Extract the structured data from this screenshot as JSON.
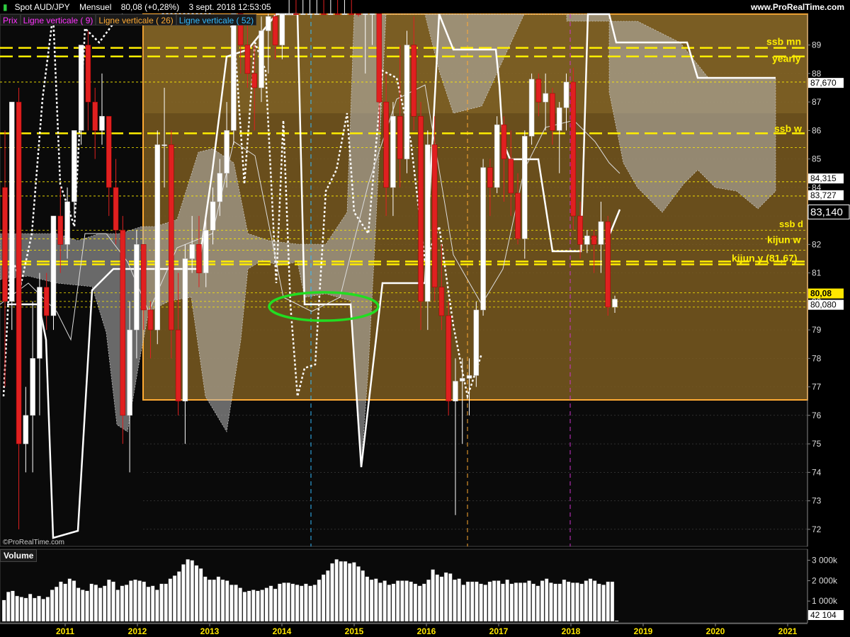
{
  "header": {
    "instrument": "Spot AUD/JPY",
    "period": "Mensuel",
    "last_change": "80,08 (+0,28%)",
    "datetime": "3 sept. 2018 12:53:05",
    "source": "www.ProRealTime.com"
  },
  "legend": [
    {
      "label": "Prix",
      "color": "#ff33ff"
    },
    {
      "label": "Ligne verticale ( 9)",
      "color": "#ff33ff"
    },
    {
      "label": "Ligne verticale ( 26)",
      "color": "#ffaa33"
    },
    {
      "label": "Ligne verticale ( 52)",
      "color": "#33bbff"
    }
  ],
  "watermark": "©ProRealTime.com",
  "volume_panel": {
    "title": "Volume",
    "last_value_label": "42 104"
  },
  "colors": {
    "bull_candle": "#ffffff",
    "bear_candle": "#e02020",
    "cloud": "#b8b8b8",
    "zone_fill": "#7a5a20",
    "zone_border": "#ffaa33",
    "key_level": "#ffee00",
    "highlight_ellipse": "#22dd22",
    "marker_9": "#cc33cc",
    "marker_26": "#ffaa33",
    "marker_52": "#33bbff"
  },
  "chart_data": {
    "type": "candlestick",
    "y_axis_ticks": [
      "72",
      "73",
      "74",
      "75",
      "76",
      "77",
      "78",
      "79",
      "80",
      "81",
      "82",
      "83",
      "84",
      "85",
      "86",
      "87",
      "88",
      "89"
    ],
    "y_range": [
      71.4,
      90.1
    ],
    "x_axis_ticks": [
      "2011",
      "2012",
      "2013",
      "2014",
      "2015",
      "2016",
      "2017",
      "2018",
      "2019",
      "2020",
      "2021"
    ],
    "price_labels": [
      "87,670",
      "84,315",
      "83,727",
      "83,140",
      "80,08",
      "80,080"
    ],
    "level_labels": [
      "ssb mn",
      "yearly",
      "ssb w",
      "ssb d",
      "kijun w",
      "kijun y (81,67)"
    ],
    "volume_axis_ticks": [
      "3 000k",
      "2 000k",
      "1 000k"
    ],
    "candles": [
      {
        "o": 84,
        "h": 86,
        "l": 77,
        "c": 80
      },
      {
        "o": 80,
        "h": 87,
        "l": 79,
        "c": 87
      },
      {
        "o": 87,
        "h": 87.5,
        "l": 72,
        "c": 75
      },
      {
        "o": 75,
        "h": 77,
        "l": 74,
        "c": 76
      },
      {
        "o": 76,
        "h": 80,
        "l": 74,
        "c": 78
      },
      {
        "o": 78,
        "h": 81,
        "l": 76,
        "c": 80.5
      },
      {
        "o": 80.5,
        "h": 81,
        "l": 79,
        "c": 79.5
      },
      {
        "o": 79.5,
        "h": 83,
        "l": 79,
        "c": 83
      },
      {
        "o": 83,
        "h": 84,
        "l": 81,
        "c": 82
      },
      {
        "o": 82,
        "h": 84,
        "l": 81.5,
        "c": 83.5
      },
      {
        "o": 83.5,
        "h": 86,
        "l": 83,
        "c": 86
      },
      {
        "o": 86,
        "h": 89,
        "l": 85.5,
        "c": 89
      },
      {
        "o": 89,
        "h": 89.5,
        "l": 86,
        "c": 87
      },
      {
        "o": 87,
        "h": 87.5,
        "l": 85,
        "c": 86
      },
      {
        "o": 86,
        "h": 88,
        "l": 85.5,
        "c": 86.5
      },
      {
        "o": 86.5,
        "h": 86.5,
        "l": 83,
        "c": 84
      },
      {
        "o": 84,
        "h": 85,
        "l": 82,
        "c": 82.5
      },
      {
        "o": 82.5,
        "h": 83,
        "l": 75,
        "c": 76
      },
      {
        "o": 76,
        "h": 80,
        "l": 74,
        "c": 79
      },
      {
        "o": 79,
        "h": 82.5,
        "l": 78,
        "c": 82
      },
      {
        "o": 82,
        "h": 82,
        "l": 79,
        "c": 79.7
      },
      {
        "o": 79.7,
        "h": 80,
        "l": 78,
        "c": 79
      },
      {
        "o": 79,
        "h": 86,
        "l": 78.5,
        "c": 85.5
      },
      {
        "o": 85.5,
        "h": 87.5,
        "l": 84,
        "c": 85.5
      },
      {
        "o": 85.5,
        "h": 86,
        "l": 78,
        "c": 79
      },
      {
        "o": 79,
        "h": 81,
        "l": 76,
        "c": 76.5
      },
      {
        "o": 76.5,
        "h": 82,
        "l": 75,
        "c": 81.5
      },
      {
        "o": 81.5,
        "h": 83,
        "l": 81,
        "c": 82
      },
      {
        "o": 82,
        "h": 83,
        "l": 80.5,
        "c": 81
      },
      {
        "o": 81,
        "h": 83,
        "l": 80.5,
        "c": 82.5
      },
      {
        "o": 82.5,
        "h": 84,
        "l": 82,
        "c": 83.5
      },
      {
        "o": 83.5,
        "h": 85,
        "l": 83,
        "c": 84.5
      },
      {
        "o": 84.5,
        "h": 87,
        "l": 84,
        "c": 86
      },
      {
        "o": 86,
        "h": 91,
        "l": 85.5,
        "c": 90.5
      },
      {
        "o": 90.5,
        "h": 92,
        "l": 88,
        "c": 89
      },
      {
        "o": 89,
        "h": 90,
        "l": 87.5,
        "c": 88
      },
      {
        "o": 88,
        "h": 89,
        "l": 86,
        "c": 87.5
      },
      {
        "o": 87.5,
        "h": 90,
        "l": 87,
        "c": 89.5
      },
      {
        "o": 89.5,
        "h": 90.5,
        "l": 88,
        "c": 90
      },
      {
        "o": 90,
        "h": 91,
        "l": 88.5,
        "c": 89
      },
      {
        "o": 89,
        "h": 92,
        "l": 88.5,
        "c": 91.5
      },
      {
        "o": 91.5,
        "h": 95,
        "l": 91,
        "c": 94
      },
      {
        "o": 94,
        "h": 96,
        "l": 92,
        "c": 93
      },
      {
        "o": 93,
        "h": 95,
        "l": 91,
        "c": 94.5
      },
      {
        "o": 94.5,
        "h": 97,
        "l": 93,
        "c": 96
      },
      {
        "o": 96,
        "h": 98,
        "l": 94,
        "c": 97
      },
      {
        "o": 97,
        "h": 99,
        "l": 95,
        "c": 96
      },
      {
        "o": 96,
        "h": 98,
        "l": 95,
        "c": 97.5
      },
      {
        "o": 97.5,
        "h": 99,
        "l": 93,
        "c": 94
      },
      {
        "o": 94,
        "h": 96,
        "l": 92,
        "c": 95
      },
      {
        "o": 95,
        "h": 97,
        "l": 92,
        "c": 93
      },
      {
        "o": 93,
        "h": 94,
        "l": 90,
        "c": 90.5
      },
      {
        "o": 90.5,
        "h": 92,
        "l": 88,
        "c": 91
      },
      {
        "o": 91,
        "h": 92.5,
        "l": 89,
        "c": 92
      },
      {
        "o": 92,
        "h": 93,
        "l": 86,
        "c": 87
      },
      {
        "o": 87,
        "h": 88,
        "l": 83,
        "c": 84
      },
      {
        "o": 84,
        "h": 87,
        "l": 83,
        "c": 86.5
      },
      {
        "o": 86.5,
        "h": 89,
        "l": 84,
        "c": 85
      },
      {
        "o": 85,
        "h": 89.5,
        "l": 84.5,
        "c": 89
      },
      {
        "o": 89,
        "h": 90,
        "l": 86,
        "c": 86.5
      },
      {
        "o": 86.5,
        "h": 87,
        "l": 79,
        "c": 80
      },
      {
        "o": 80,
        "h": 86,
        "l": 79,
        "c": 85.5
      },
      {
        "o": 85.5,
        "h": 86.5,
        "l": 80,
        "c": 80.5
      },
      {
        "o": 80.5,
        "h": 82,
        "l": 79,
        "c": 79.5
      },
      {
        "o": 79.5,
        "h": 80,
        "l": 76,
        "c": 76.5
      },
      {
        "o": 76.5,
        "h": 78,
        "l": 72.5,
        "c": 77.2
      },
      {
        "o": 77.2,
        "h": 78,
        "l": 75,
        "c": 77.3
      },
      {
        "o": 77.3,
        "h": 78,
        "l": 76,
        "c": 77.4
      },
      {
        "o": 77.4,
        "h": 80,
        "l": 77,
        "c": 79.7
      },
      {
        "o": 79.7,
        "h": 85,
        "l": 79.5,
        "c": 84.7
      },
      {
        "o": 84.7,
        "h": 85,
        "l": 83,
        "c": 84
      },
      {
        "o": 84,
        "h": 86.5,
        "l": 83.8,
        "c": 86.2
      },
      {
        "o": 86.2,
        "h": 86.5,
        "l": 83.5,
        "c": 85
      },
      {
        "o": 85,
        "h": 86,
        "l": 83,
        "c": 83.8
      },
      {
        "o": 83.8,
        "h": 84.5,
        "l": 82,
        "c": 82.2
      },
      {
        "o": 82.2,
        "h": 86,
        "l": 81.5,
        "c": 85.8
      },
      {
        "o": 85.8,
        "h": 88,
        "l": 85.5,
        "c": 87.8
      },
      {
        "o": 87.8,
        "h": 88,
        "l": 86.5,
        "c": 87
      },
      {
        "o": 87,
        "h": 88,
        "l": 86,
        "c": 87.3
      },
      {
        "o": 87.3,
        "h": 87.5,
        "l": 85.5,
        "c": 86
      },
      {
        "o": 86,
        "h": 87,
        "l": 84.5,
        "c": 86.8
      },
      {
        "o": 86.8,
        "h": 88,
        "l": 86,
        "c": 87.7
      },
      {
        "o": 87.7,
        "h": 88.2,
        "l": 82.5,
        "c": 83
      },
      {
        "o": 83,
        "h": 83.5,
        "l": 81.5,
        "c": 82
      },
      {
        "o": 82,
        "h": 82.5,
        "l": 81.7,
        "c": 82.3
      },
      {
        "o": 82.3,
        "h": 82.5,
        "l": 81,
        "c": 82
      },
      {
        "o": 82,
        "h": 83.5,
        "l": 81,
        "c": 82.8
      },
      {
        "o": 82.8,
        "h": 83,
        "l": 79.5,
        "c": 79.8
      },
      {
        "o": 79.8,
        "h": 80.2,
        "l": 79.6,
        "c": 80.08
      }
    ],
    "volume_series": [
      1050,
      1450,
      1500,
      1250,
      1200,
      1150,
      1350,
      1150,
      1250,
      1100,
      1200,
      1550,
      1700,
      1950,
      1850,
      2100,
      2000,
      1650,
      1550,
      1500,
      1850,
      1800,
      1650,
      1750,
      2050,
      1950,
      1550,
      1750,
      1800,
      2000,
      2050,
      2000,
      1950,
      1700,
      1750,
      1550,
      1850,
      1850,
      2100,
      2250,
      2450,
      2800,
      3050,
      3000,
      2750,
      2600,
      2200,
      2050,
      2050,
      2200,
      2050,
      2000,
      1800,
      1800,
      1650,
      1450,
      1500,
      1550,
      1500,
      1550,
      1650,
      1750,
      1600,
      1850,
      1900,
      1900,
      1850,
      1800,
      1750,
      1850,
      1750,
      1800,
      2050,
      2300,
      2500,
      2850,
      3050,
      2950,
      2950,
      2850,
      2900,
      2700,
      2500,
      2200,
      2050,
      2100,
      1900,
      2000,
      1800,
      1850,
      2000,
      2000,
      2000,
      1950,
      1850,
      1750,
      1850,
      2050,
      2550,
      2300,
      2200,
      2400,
      2350,
      2050,
      2100,
      1800,
      1950,
      1950,
      1950,
      1850,
      1800,
      1950,
      2000,
      2000,
      1850,
      2050,
      1850,
      1900,
      1900,
      1900,
      2000,
      1850,
      1750,
      2000,
      2100,
      1900,
      1850,
      1850,
      2050,
      1950,
      1900,
      1900,
      1850,
      2000,
      2100,
      2000,
      1850,
      1800,
      1950,
      1950,
      42
    ]
  }
}
